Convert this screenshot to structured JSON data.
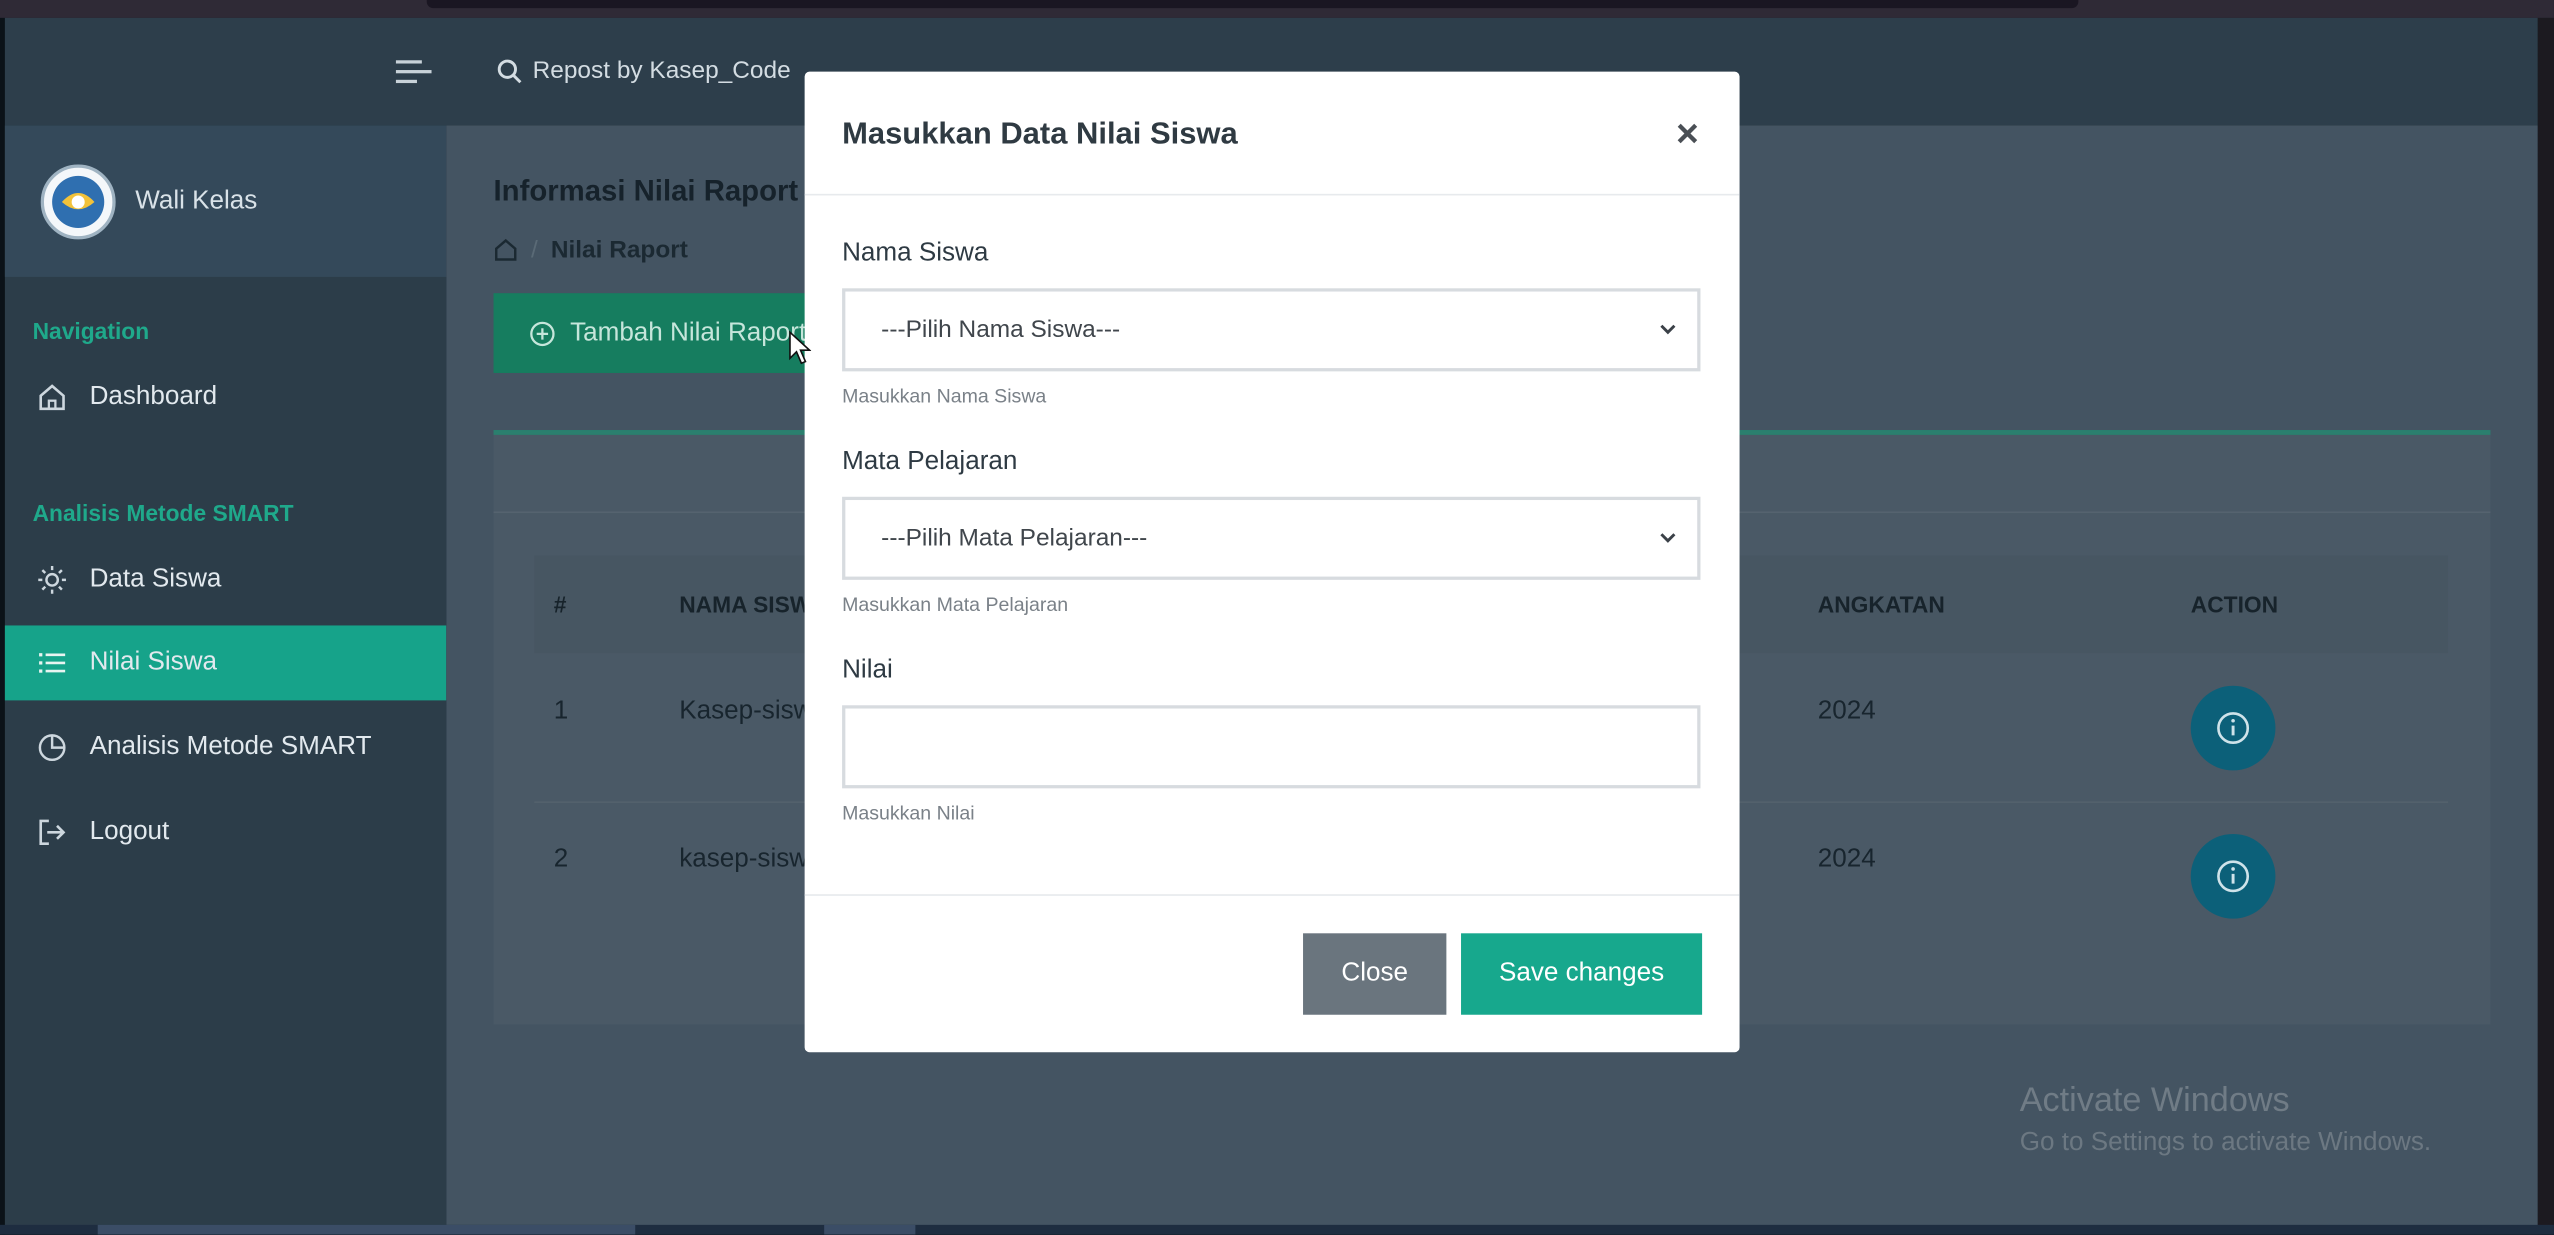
{
  "header": {
    "search_text": "Repost by Kasep_Code"
  },
  "sidebar": {
    "brand_name": "Wali Kelas",
    "sections": [
      {
        "heading": "Navigation"
      },
      {
        "heading": "Analisis Metode SMART"
      }
    ],
    "items": [
      {
        "label": "Dashboard",
        "icon": "home-icon"
      },
      {
        "label": "Data Siswa",
        "icon": "sun-icon"
      },
      {
        "label": "Nilai Siswa",
        "icon": "list-icon",
        "active": true
      },
      {
        "label": "Analisis Metode SMART",
        "icon": "pie-chart-icon"
      },
      {
        "label": "Logout",
        "icon": "logout-icon"
      }
    ]
  },
  "main": {
    "page_title": "Informasi Nilai Raport",
    "breadcrumb": {
      "current": "Nilai Raport",
      "separator": "/"
    },
    "add_button_label": "Tambah Nilai Raport",
    "table": {
      "headers": [
        "#",
        "NAMA SISWA",
        "ANGKATAN",
        "ACTION"
      ],
      "rows": [
        {
          "no": "1",
          "name": "Kasep-siswa",
          "angkatan": "2024"
        },
        {
          "no": "2",
          "name": "kasep-siswa",
          "angkatan": "2024"
        }
      ]
    }
  },
  "modal": {
    "title": "Masukkan Data Nilai Siswa",
    "fields": [
      {
        "label": "Nama Siswa",
        "selected": "---Pilih Nama Siswa---",
        "help": "Masukkan Nama Siswa"
      },
      {
        "label": "Mata Pelajaran",
        "selected": "---Pilih Mata Pelajaran---",
        "help": "Masukkan Mata Pelajaran"
      },
      {
        "label": "Nilai",
        "value": "",
        "help": "Masukkan Nilai"
      }
    ],
    "close_label": "Close",
    "save_label": "Save changes"
  },
  "watermark": {
    "line1": "Activate Windows",
    "line2": "Go to Settings to activate Windows."
  },
  "colors": {
    "accent": "#16a38a",
    "header_bg": "#2d3e4b",
    "sidebar_bg": "#2c3d49",
    "info_button": "#0c6079",
    "close_button": "#6a757e"
  }
}
